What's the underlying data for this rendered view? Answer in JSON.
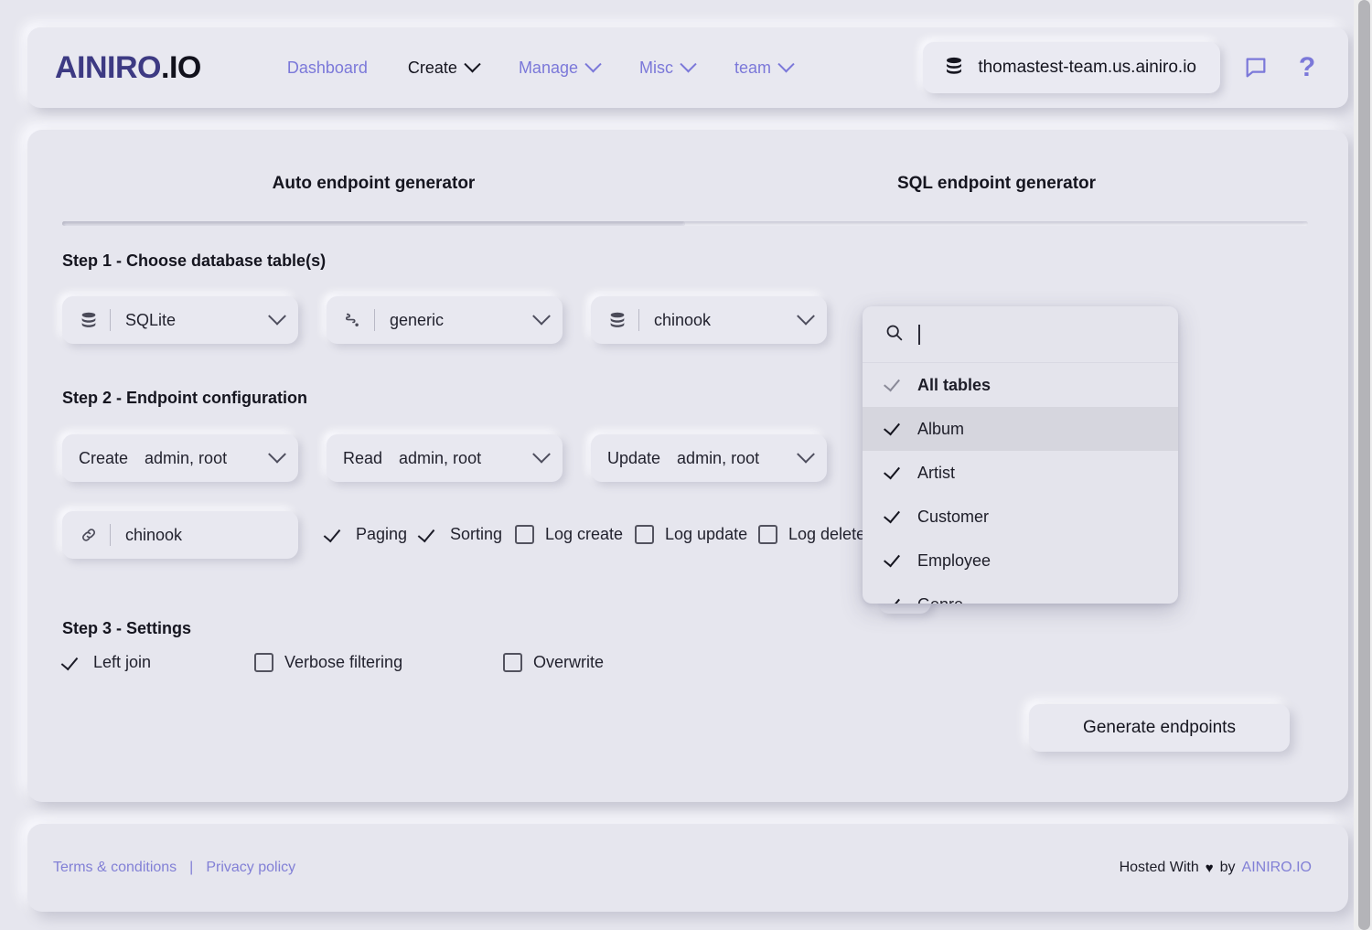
{
  "header": {
    "logo": {
      "part1": "AINIRO",
      "part2": ".IO"
    },
    "nav": [
      {
        "label": "Dashboard",
        "has_caret": false,
        "active": false
      },
      {
        "label": "Create",
        "has_caret": true,
        "active": true
      },
      {
        "label": "Manage",
        "has_caret": true,
        "active": false
      },
      {
        "label": "Misc",
        "has_caret": true,
        "active": false
      },
      {
        "label": "team",
        "has_caret": true,
        "active": false
      }
    ],
    "team_selector": {
      "icon": "database-icon",
      "value": "thomastest-team.us.ainiro.io"
    },
    "chat_icon": "chat-bubble-icon",
    "help_icon": "question-mark-icon",
    "accent_color": "#7b78d9"
  },
  "tabs": [
    {
      "label": "Auto endpoint generator",
      "active": true
    },
    {
      "label": "SQL endpoint generator",
      "active": false
    }
  ],
  "step1": {
    "title": "Step 1 - Choose database table(s)",
    "controls": [
      {
        "icon": "database-icon",
        "value": "SQLite"
      },
      {
        "icon": "route-icon",
        "value": "generic"
      },
      {
        "icon": "database-icon",
        "value": "chinook"
      }
    ]
  },
  "step2": {
    "title": "Step 2 - Endpoint configuration",
    "verbs": [
      {
        "verb": "Create",
        "roles": "admin, root"
      },
      {
        "verb": "Read",
        "roles": "admin, root"
      },
      {
        "verb": "Update",
        "roles": "admin, root"
      }
    ],
    "module": {
      "icon": "link-icon",
      "value": "chinook"
    },
    "options": [
      {
        "label": "Paging",
        "checked": true
      },
      {
        "label": "Sorting",
        "checked": true
      },
      {
        "label": "Log create",
        "checked": false
      },
      {
        "label": "Log update",
        "checked": false
      },
      {
        "label": "Log delete",
        "checked": false
      }
    ]
  },
  "step3": {
    "title": "Step 3 - Settings",
    "options": [
      {
        "label": "Left join",
        "checked": true
      },
      {
        "label": "Verbose filtering",
        "checked": false
      },
      {
        "label": "Overwrite",
        "checked": false
      }
    ]
  },
  "generate_button": {
    "label": "Generate endpoints"
  },
  "dropdown": {
    "search_icon": "search-icon",
    "search_value": "",
    "items": [
      {
        "label": "All tables",
        "checked": true,
        "bold": true,
        "hover": false,
        "faint_check": true
      },
      {
        "label": "Album",
        "checked": true,
        "bold": false,
        "hover": true,
        "faint_check": false
      },
      {
        "label": "Artist",
        "checked": true,
        "bold": false,
        "hover": false,
        "faint_check": false
      },
      {
        "label": "Customer",
        "checked": true,
        "bold": false,
        "hover": false,
        "faint_check": false
      },
      {
        "label": "Employee",
        "checked": true,
        "bold": false,
        "hover": false,
        "faint_check": false
      },
      {
        "label": "Genre",
        "checked": true,
        "bold": false,
        "hover": false,
        "faint_check": false
      }
    ]
  },
  "footer": {
    "terms_label": "Terms & conditions",
    "separator": "|",
    "privacy_label": "Privacy policy",
    "hosted_prefix": "Hosted With",
    "heart": "♥",
    "hosted_by": "by",
    "brand": "AINIRO.IO"
  }
}
